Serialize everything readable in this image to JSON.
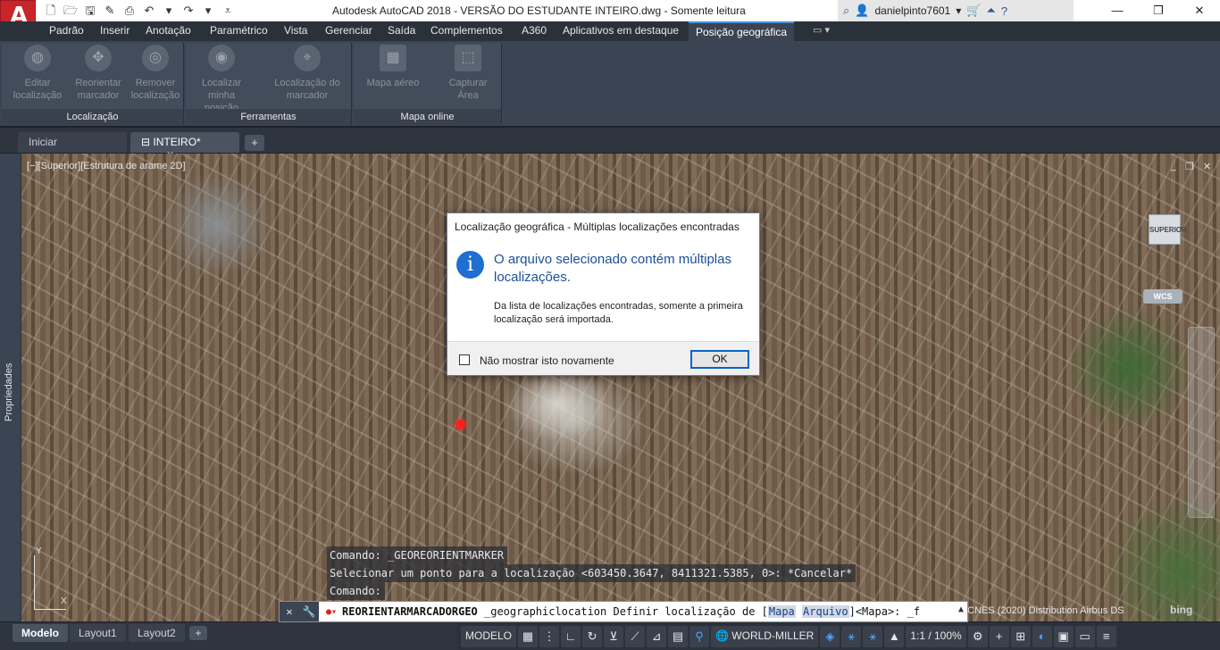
{
  "title_bar": {
    "title": "Autodesk AutoCAD 2018 - VERSÃO DO ESTUDANTE    INTEIRO.dwg - Somente leitura",
    "app_letter": "A",
    "user_name": "danielpinto7601",
    "user_caret": "▾"
  },
  "ribbon_tabs": [
    "Padrão",
    "Inserir",
    "Anotação",
    "Paramétrico",
    "Vista",
    "Gerenciar",
    "Saída",
    "Complementos",
    "A360",
    "Aplicativos em destaque",
    "Posição geográfica"
  ],
  "ribbon_active_tab": "Posição geográfica",
  "ribbon": {
    "panels": [
      {
        "title": "Localização",
        "buttons": [
          {
            "label": "Editar localização",
            "icon": "globe-edit-icon"
          },
          {
            "label": "Reorientar marcador",
            "icon": "move-marker-icon"
          },
          {
            "label": "Remover localização",
            "icon": "globe-remove-icon"
          }
        ]
      },
      {
        "title": "Ferramentas",
        "buttons": [
          {
            "label": "Localizar minha posição",
            "icon": "locate-icon"
          },
          {
            "label": "Localização do marcador",
            "icon": "marker-location-icon"
          }
        ]
      },
      {
        "title": "Mapa online",
        "buttons": [
          {
            "label": "Mapa aéreo",
            "icon": "aerial-map-icon"
          },
          {
            "label": "Capturar Área",
            "icon": "capture-area-icon"
          }
        ]
      }
    ]
  },
  "file_tabs": {
    "start": "Iniciar",
    "active": "INTEIRO*",
    "close": "✕",
    "add": "+"
  },
  "viewport": {
    "label": "[−][Superior][Estrutura de arame 2D]",
    "viewcube_label": "SUPERIOR",
    "wcs_label": "WCS",
    "ucs_x": "X",
    "ucs_y": "Y",
    "attribution": "© CNES (2020) Distribution Airbus DS",
    "bing": "bing",
    "controls": [
      "_",
      "❐",
      "✕"
    ]
  },
  "properties_label": "Propriedades",
  "command_history": [
    "Comando:  _GEOREORIENTMARKER",
    "Selecionar um ponto para a localização <603450.3647, 8411321.5385, 0>: *Cancelar*",
    "Comando:"
  ],
  "command_line": {
    "command": "REORIENTARMARCADORGEO",
    "prefix": " _geographiclocation Definir localização de [",
    "option1": "Mapa",
    "option2": "Arquivo",
    "suffix": "]<Mapa>: _f"
  },
  "layout_tabs": [
    "Modelo",
    "Layout1",
    "Layout2"
  ],
  "layout_add": "+",
  "status_bar": {
    "model": "MODELO",
    "world": "WORLD-MILLER",
    "scale": "1:1 / 100%"
  },
  "dialog": {
    "title": "Localização geográfica - Múltiplas localizações encontradas",
    "heading": "O arquivo selecionado contém múltiplas localizações.",
    "body": "Da lista de localizações encontradas, somente a primeira localização será importada.",
    "checkbox_label": "Não mostrar isto novamente",
    "checkbox_checked": false,
    "ok_label": "OK",
    "info_glyph": "i"
  },
  "colors": {
    "autocad_red": "#c8252b",
    "ribbon_bg": "#3b4453",
    "dialog_heading": "#1a4f9c",
    "marker": "#ff2020"
  }
}
